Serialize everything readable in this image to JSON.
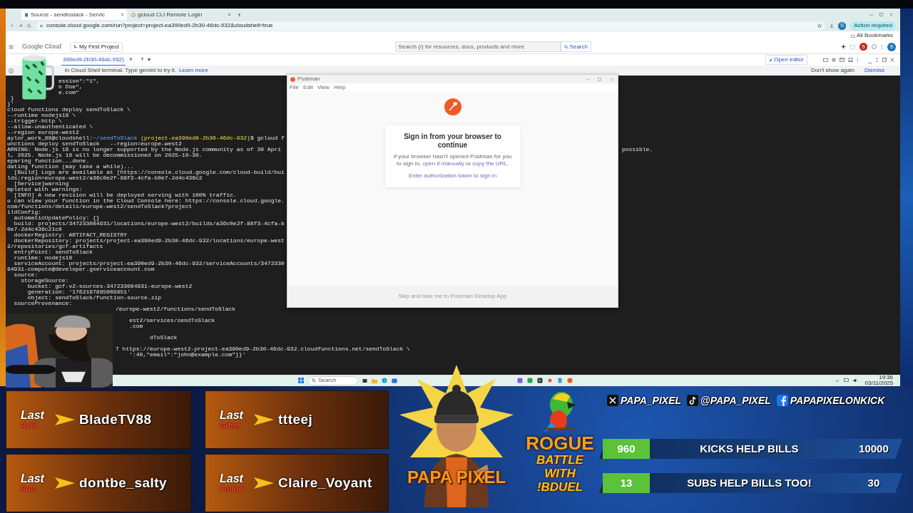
{
  "browser": {
    "tabs": [
      {
        "title": "Source - sendtoslack - Servic",
        "selected": true
      },
      {
        "title": "gcloud CLI Remote Login",
        "selected": false
      }
    ],
    "new_tab": "+",
    "url": "console.cloud.google.com/run?project=project-ea390ed9-2b30-46dc-932&cloudshell=true",
    "profile": "S",
    "action_chip": "Action required",
    "bookmarks": "All Bookmarks"
  },
  "console_header": {
    "brand": "Google Cloud",
    "project": "My First Project",
    "search_placeholder": "Search (/) for resources, docs, products and more",
    "search_button": "Search",
    "notifications": "5",
    "avatar": "S"
  },
  "shell": {
    "tab": "390ed9-2b30-46dc-932)",
    "tab_close": "×",
    "add": "+",
    "menu": "▾",
    "open_editor": "Open editor",
    "minimize": "_",
    "banner": "in Cloud Shell terminal. Type gemini to try it.",
    "banner_link": "Learn more",
    "dont_show": "Don't show again",
    "dismiss": "Dismiss"
  },
  "terminal": {
    "lines": [
      {
        "kind": "indented",
        "text": "ession\":\"1\","
      },
      {
        "kind": "indented",
        "text": "n Doe\","
      },
      {
        "kind": "indented",
        "text": "e.com\""
      },
      {
        "kind": "plain",
        "text": " }"
      },
      {
        "kind": "plain",
        "text": "}'"
      },
      {
        "kind": "plain",
        "text": "cloud functions deploy sendToSlack \\"
      },
      {
        "kind": "plain",
        "text": "--runtime nodejs18 \\"
      },
      {
        "kind": "plain",
        "text": "--trigger-http \\"
      },
      {
        "kind": "plain",
        "text": "--allow-unauthenticated \\"
      },
      {
        "kind": "plain",
        "text": "--region europe-west2"
      },
      {
        "kind": "prompt",
        "user": "aylor_work_88@cloudshell:",
        "path": "~/sendToSlack",
        "project": "(project-ea390ed9-2b30-46dc-932)",
        "command": "$ gcloud functions deploy sendToSlack   --region=europe-west2"
      },
      {
        "kind": "plain",
        "text": "ARNING: Node.js 18 is no longer supported by the Node.js community as of 30 April, 2025. Node.js 18 will be decommissioned on 2025-10-30.",
        "right": "possible."
      },
      {
        "kind": "plain",
        "text": "eparing function...done."
      },
      {
        "kind": "plain",
        "text": "dating function (may take a while)..."
      },
      {
        "kind": "plain",
        "text": "  [Build] Logs are available at [https://console.cloud.google.com/cloud-build/builds;region=europe-west2/a36c0e2f-88f3-4cfa-b0e7-2d4c436c2"
      },
      {
        "kind": "plain",
        "text": "  [Service]warning"
      },
      {
        "kind": "plain",
        "text": "mpleted with warnings:"
      },
      {
        "kind": "plain",
        "text": "  [INFO] A new revision will be deployed serving with 100% traffic."
      },
      {
        "kind": "plain",
        "text": "u can view your function in the Cloud Console here: https://console.cloud.google.com/functions/details/europe-west2/sendToSlack?project"
      },
      {
        "kind": "plain",
        "text": "ildConfig:"
      },
      {
        "kind": "plain",
        "text": "  automaticUpdatePolicy: {}"
      },
      {
        "kind": "plain",
        "text": "  build: projects/347233084931/locations/europe-west2/builds/a36c0e2f-88f3-4cfa-b0e7-2d4c436c21c0"
      },
      {
        "kind": "plain",
        "text": "  dockerRegistry: ARTIFACT_REGISTRY"
      },
      {
        "kind": "plain",
        "text": "  dockerRepository: projects/project-ea390ed9-2b30-46dc-932/locations/europe-west2/repositories/gcf-artifacts"
      },
      {
        "kind": "plain",
        "text": "  entryPoint: sendToSlack"
      },
      {
        "kind": "plain",
        "text": "  runtime: nodejs18"
      },
      {
        "kind": "plain",
        "text": "  serviceAccount: projects/project-ea390ed9-2b30-46dc-932/serviceAccounts/347233084931-compute@developer.gserviceaccount.com"
      },
      {
        "kind": "plain",
        "text": "  source:"
      },
      {
        "kind": "plain",
        "text": "    storageSource:"
      },
      {
        "kind": "plain",
        "text": "      bucket: gcf-v2-sources-347233084931-europe-west2"
      },
      {
        "kind": "plain",
        "text": "      generation: '1762197885009851'"
      },
      {
        "kind": "plain",
        "text": "      object: sendToSlack/function-source.zip"
      },
      {
        "kind": "plain",
        "text": "  sourceProvenance:"
      },
      {
        "kind": "camera",
        "text": "/europe-west2/functions/sendToSlack"
      },
      {
        "kind": "blank"
      },
      {
        "kind": "camera",
        "text": "    est2/services/sendToSlack"
      },
      {
        "kind": "camera",
        "text": "    .com"
      },
      {
        "kind": "blank"
      },
      {
        "kind": "camera",
        "text": "          dToSlack"
      },
      {
        "kind": "blank"
      },
      {
        "kind": "camera",
        "text": "T https://europe-west2-project-ea390ed9-2b30-46dc-932.cloudfunctions.net/sendToSlack \\"
      },
      {
        "kind": "camera",
        "text": "    ':40,\"email\":\"john@example.com\"}}'"
      }
    ]
  },
  "postman": {
    "title": "Postman",
    "menu": [
      "File",
      "Edit",
      "View",
      "Help"
    ],
    "heading": "Sign in from your browser to continue",
    "body": {
      "before": "If your browser hasn't opened Postman for you to sign in, ",
      "link_1": "open it manually",
      "between": " or ",
      "link_2": "copy the URL",
      "after": "."
    },
    "token_link": "Enter authorization token to sign in",
    "footer": "Skip and take me to Postman Desktop App"
  },
  "taskbar": {
    "search": "Search",
    "time": "19:36",
    "date": "03/11/2025"
  },
  "overlay": {
    "recent": [
      {
        "caption": "Last",
        "event": "Raid",
        "name": "BladeTV88"
      },
      {
        "caption": "Last",
        "event": "Gifter",
        "name": "ttteej"
      },
      {
        "caption": "Last",
        "event": "Sub",
        "name": "dontbe_salty"
      },
      {
        "caption": "Last",
        "event": "Follow",
        "name": "Claire_Voyant"
      }
    ],
    "logo": "PAPA PIXEL",
    "battle": {
      "title": "ROGUE",
      "lines": [
        "BATTLE",
        "WITH",
        "!BDUEL"
      ]
    },
    "socials": [
      {
        "kind": "x",
        "handle": "PAPA_PIXEL"
      },
      {
        "kind": "tiktok",
        "handle": "@PAPA_PIXEL"
      },
      {
        "kind": "facebook",
        "handle": "PAPAPIXELONKICK"
      }
    ],
    "goals": [
      {
        "current": "960",
        "label": "KICKS HELP BILLS",
        "target": "10000"
      },
      {
        "current": "13",
        "label": "SUBS HELP BILLS TOO!",
        "target": "30"
      }
    ]
  }
}
